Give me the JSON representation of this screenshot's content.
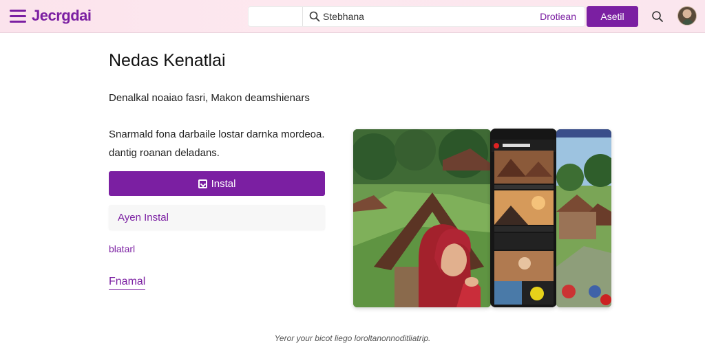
{
  "header": {
    "brand": "Jecrgdai",
    "search": {
      "placeholder": "Stebhana",
      "link_label": "Drotiean"
    },
    "action_button": "Asetil",
    "icons": {
      "menu": "hamburger-menu-icon",
      "search": "search-icon",
      "avatar": "user-avatar"
    }
  },
  "main": {
    "title": "Nedas Kenatlai",
    "subtitle": "Denalkal noaiao fasri, Makon deamshienars",
    "description": "Snarmald fona darbaile lostar darnka mordeoa. dantig roanan deladans.",
    "primary_button": "Instal",
    "secondary_button": "Ayen Instal",
    "link_one": "blatarl",
    "link_two": "Fnamal"
  },
  "footer": {
    "note": "Yeror your bicot liego loroltanonnoditliatrip."
  },
  "colors": {
    "accent": "#7b1fa2",
    "header_bg": "#fde8ef",
    "text": "#222222"
  }
}
